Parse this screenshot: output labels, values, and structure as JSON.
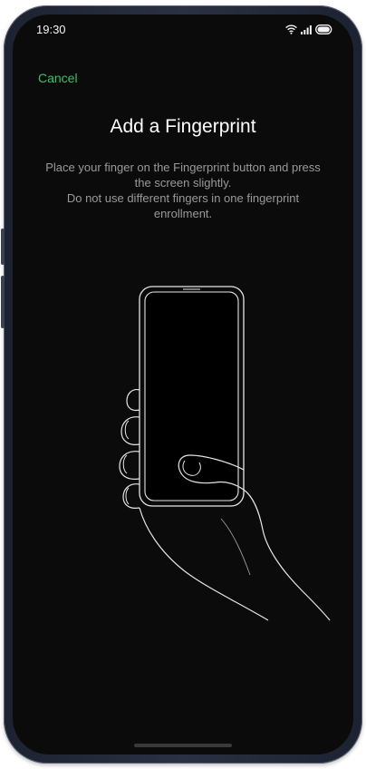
{
  "status_bar": {
    "time": "19:30"
  },
  "header": {
    "cancel_label": "Cancel"
  },
  "main": {
    "title": "Add a Fingerprint",
    "instruction_line_1": "Place your finger on the Fingerprint button and press the screen slightly.",
    "instruction_line_2": "Do not use different fingers in one fingerprint enrollment."
  },
  "colors": {
    "background": "#0b0b0b",
    "accent": "#33c16a",
    "title": "#ffffff",
    "body_text": "#9a9a9a"
  },
  "icons": [
    "wifi-icon",
    "signal-icon",
    "battery-icon",
    "hand-holding-phone-illustration"
  ]
}
